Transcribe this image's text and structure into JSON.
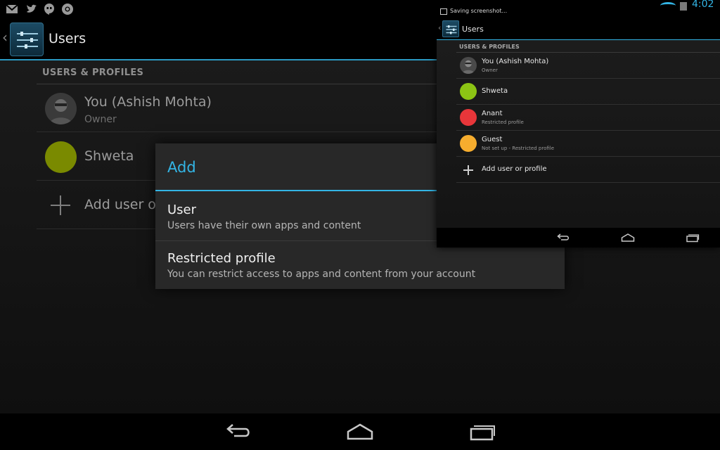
{
  "main": {
    "status_icons": [
      "gmail-icon",
      "twitter-icon",
      "hangouts-icon",
      "chrome-icon"
    ],
    "action_bar": {
      "title": "Users"
    },
    "section_header": "USERS & PROFILES",
    "users": [
      {
        "name": "You (Ashish Mohta)",
        "subtitle": "Owner"
      },
      {
        "name": "Shweta",
        "avatar_color": "#7a8a00"
      }
    ],
    "add_label": "Add user or",
    "accent_color": "#33b5e5"
  },
  "dialog": {
    "title": "Add",
    "options": [
      {
        "title": "User",
        "subtitle": "Users have their own apps and content"
      },
      {
        "title": "Restricted profile",
        "subtitle": "You can restrict access to apps and content from your account"
      }
    ]
  },
  "thumbnail": {
    "notification": "Saving screenshot...",
    "time": "4:02",
    "action_bar": {
      "title": "Users"
    },
    "section_header": "USERS & PROFILES",
    "users": [
      {
        "name": "You (Ashish Mohta)",
        "subtitle": "Owner"
      },
      {
        "name": "Shweta",
        "avatar_color": "#8cc414"
      },
      {
        "name": "Anant",
        "subtitle": "Restricted profile",
        "avatar_color": "#e8363a"
      },
      {
        "name": "Guest",
        "subtitle": "Not set up - Restricted profile",
        "avatar_color": "#f6ad2e"
      }
    ],
    "add_label": "Add user or profile"
  }
}
